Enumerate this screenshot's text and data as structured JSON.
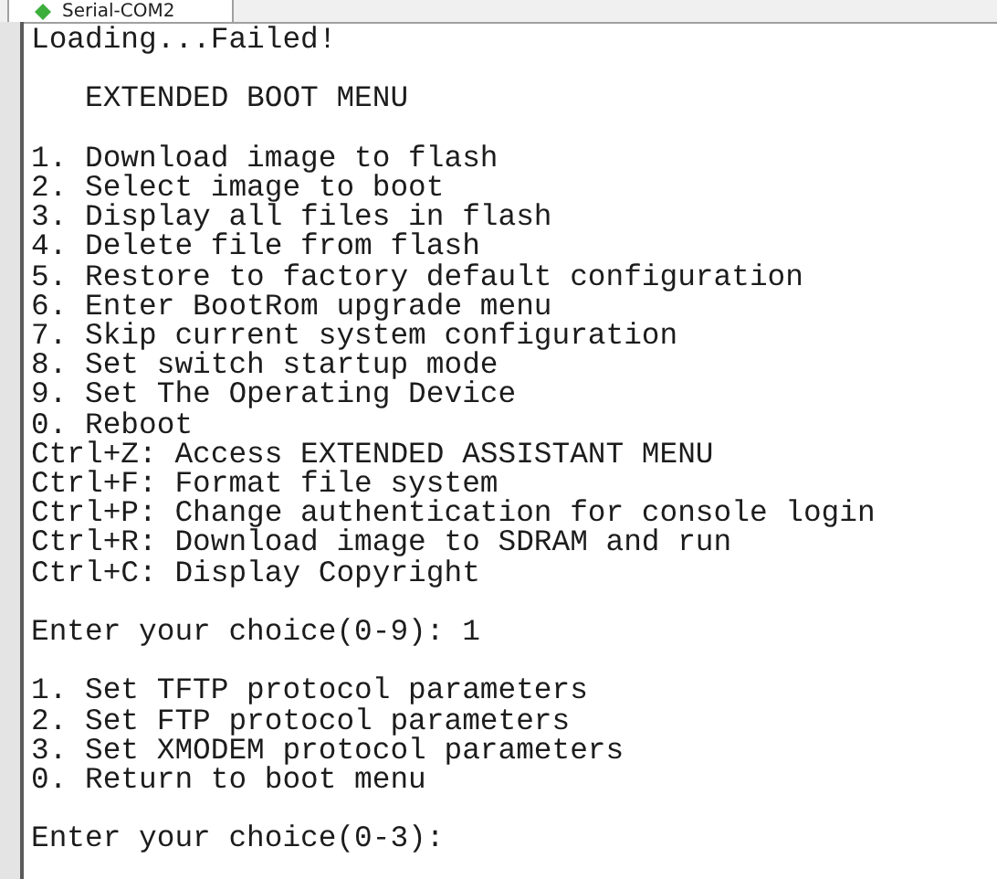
{
  "tab": {
    "title": "Serial-COM2"
  },
  "terminal": {
    "blocks": [
      [
        "Loading...Failed!"
      ],
      [
        "   EXTENDED BOOT MENU"
      ],
      [
        "1. Download image to flash",
        "2. Select image to boot",
        "3. Display all files in flash",
        "4. Delete file from flash",
        "5. Restore to factory default configuration",
        "6. Enter BootRom upgrade menu",
        "7. Skip current system configuration",
        "8. Set switch startup mode",
        "9. Set The Operating Device",
        "0. Reboot",
        "Ctrl+Z: Access EXTENDED ASSISTANT MENU",
        "Ctrl+F: Format file system",
        "Ctrl+P: Change authentication for console login",
        "Ctrl+R: Download image to SDRAM and run",
        "Ctrl+C: Display Copyright"
      ],
      [
        "Enter your choice(0-9): 1"
      ],
      [
        "1. Set TFTP protocol parameters",
        "2. Set FTP protocol parameters",
        "3. Set XMODEM protocol parameters",
        "0. Return to boot menu"
      ],
      [
        "Enter your choice(0-3):"
      ]
    ]
  }
}
